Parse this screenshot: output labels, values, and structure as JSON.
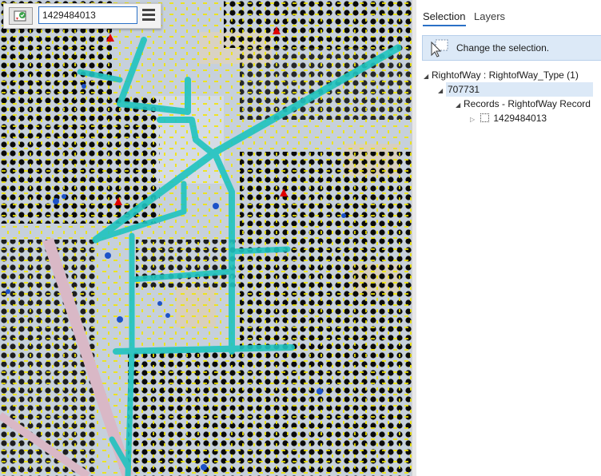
{
  "search": {
    "value": "1429484013"
  },
  "panel": {
    "tabs": [
      {
        "label": "Selection",
        "active": true
      },
      {
        "label": "Layers",
        "active": false
      }
    ],
    "change_selection_label": "Change the selection.",
    "tree": {
      "layer": "RightofWay : RightofWay_Type (1)",
      "record_id": "707731",
      "relationship": "Records - RightofWay Record",
      "child_record": "1429484013"
    }
  },
  "icons": {
    "tool": "locate-select-icon",
    "menu": "hamburger-menu-icon",
    "change": "select-arrow-icon",
    "expanded": "triangle-expanded-icon",
    "collapsed": "triangle-collapsed-icon",
    "record": "record-checkbox-icon"
  },
  "colors": {
    "map_background": "#c9d3de",
    "selection_highlight": "#1fc3c0",
    "features_dark": "#0a0a0a",
    "features_yellow": "#f2e600",
    "accent": "#2a70c7",
    "selected_row": "#dce9f7"
  }
}
